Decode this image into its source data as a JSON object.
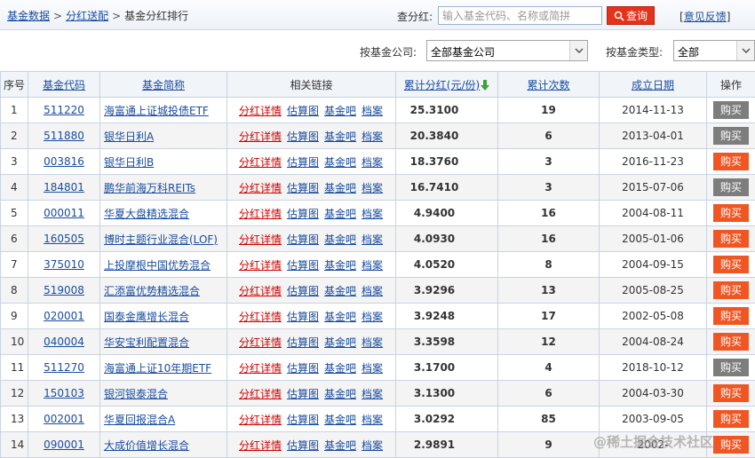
{
  "breadcrumb": {
    "item1": "基金数据",
    "sep1": ">",
    "item2": "分红送配",
    "sep2": ">",
    "current": "基金分红排行"
  },
  "search": {
    "label": "查分红:",
    "placeholder": "输入基金代码、名称或简拼",
    "button_label": "查询",
    "icon": "search-icon"
  },
  "feedback": {
    "open": "[",
    "label": "意见反馈",
    "close": "]"
  },
  "filters": {
    "company_label": "按基金公司:",
    "company_value": "全部基金公司",
    "type_label": "按基金类型:",
    "type_value": "全部"
  },
  "table": {
    "headers": {
      "no": "序号",
      "code": "基金代码",
      "name": "基金简称",
      "links": "相关链接",
      "dividend": "累计分红(元/份)",
      "count": "累计次数",
      "date": "成立日期",
      "op": "操作"
    },
    "link_labels": {
      "detail": "分红详情",
      "chart": "估算图",
      "forum": "基金吧",
      "archive": "档案"
    },
    "buy_label": "购买",
    "colors": {
      "buy_active": "#f05623",
      "buy_disabled": "#7d7d7d",
      "detail_link": "#d00000",
      "link": "#1a4da0",
      "sort_arrow": "#3aa43a"
    },
    "rows": [
      {
        "no": "1",
        "code": "511220",
        "name": "海富通上证城投债ETF",
        "dividend": "25.3100",
        "count": "19",
        "date": "2014-11-13",
        "buy_active": false
      },
      {
        "no": "2",
        "code": "511880",
        "name": "银华日利A",
        "dividend": "20.3840",
        "count": "6",
        "date": "2013-04-01",
        "buy_active": false
      },
      {
        "no": "3",
        "code": "003816",
        "name": "银华日利B",
        "dividend": "18.3760",
        "count": "3",
        "date": "2016-11-23",
        "buy_active": true
      },
      {
        "no": "4",
        "code": "184801",
        "name": "鹏华前海万科REITs",
        "dividend": "16.7410",
        "count": "3",
        "date": "2015-07-06",
        "buy_active": false
      },
      {
        "no": "5",
        "code": "000011",
        "name": "华夏大盘精选混合",
        "dividend": "4.9400",
        "count": "16",
        "date": "2004-08-11",
        "buy_active": true
      },
      {
        "no": "6",
        "code": "160505",
        "name": "博时主题行业混合(LOF)",
        "dividend": "4.0930",
        "count": "16",
        "date": "2005-01-06",
        "buy_active": true
      },
      {
        "no": "7",
        "code": "375010",
        "name": "上投摩根中国优势混合",
        "dividend": "4.0520",
        "count": "8",
        "date": "2004-09-15",
        "buy_active": true
      },
      {
        "no": "8",
        "code": "519008",
        "name": "汇添富优势精选混合",
        "dividend": "3.9296",
        "count": "13",
        "date": "2005-08-25",
        "buy_active": true
      },
      {
        "no": "9",
        "code": "020001",
        "name": "国泰金鹰增长混合",
        "dividend": "3.9248",
        "count": "17",
        "date": "2002-05-08",
        "buy_active": true
      },
      {
        "no": "10",
        "code": "040004",
        "name": "华安宝利配置混合",
        "dividend": "3.3598",
        "count": "12",
        "date": "2004-08-24",
        "buy_active": true
      },
      {
        "no": "11",
        "code": "511270",
        "name": "海富通上证10年期ETF",
        "dividend": "3.1700",
        "count": "4",
        "date": "2018-10-12",
        "buy_active": false
      },
      {
        "no": "12",
        "code": "150103",
        "name": "银河银泰混合",
        "dividend": "3.1300",
        "count": "6",
        "date": "2004-03-30",
        "buy_active": true
      },
      {
        "no": "13",
        "code": "002001",
        "name": "华夏回报混合A",
        "dividend": "3.0292",
        "count": "85",
        "date": "2003-09-05",
        "buy_active": true
      },
      {
        "no": "14",
        "code": "090001",
        "name": "大成价值增长混合",
        "dividend": "2.9891",
        "count": "9",
        "date": "2002-",
        "buy_active": true
      }
    ]
  },
  "watermark": "@稀土掘金技术社区"
}
